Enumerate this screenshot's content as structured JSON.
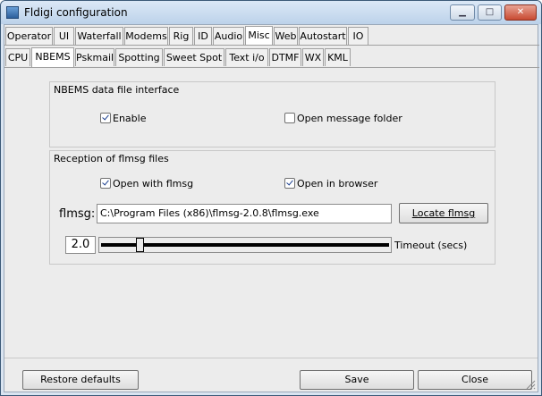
{
  "window": {
    "title": "Fldigi configuration"
  },
  "tabs_top": [
    "Operator",
    "UI",
    "Waterfall",
    "Modems",
    "Rig",
    "ID",
    "Audio",
    "Misc",
    "Web",
    "Autostart",
    "IO"
  ],
  "tabs_top_active": "Misc",
  "tabs_sub": [
    "CPU",
    "NBEMS",
    "Pskmail",
    "Spotting",
    "Sweet Spot",
    "Text i/o",
    "DTMF",
    "WX",
    "KML"
  ],
  "tabs_sub_active": "NBEMS",
  "nbems_interface": {
    "title": "NBEMS data file interface",
    "enable_label": "Enable",
    "enable_checked": true,
    "open_folder_label": "Open message folder",
    "open_folder_checked": false
  },
  "flmsg_reception": {
    "title": "Reception of flmsg files",
    "open_with_label": "Open with flmsg",
    "open_with_checked": true,
    "open_browser_label": "Open in browser",
    "open_browser_checked": true,
    "path_label": "flmsg:",
    "path_value": "C:\\Program Files (x86)\\flmsg-2.0.8\\flmsg.exe",
    "locate_label": "Locate flmsg",
    "timeout_value": "2.0",
    "timeout_label": "Timeout (secs)",
    "timeout_fraction": 0.13
  },
  "footer": {
    "restore_label": "Restore defaults",
    "save_label": "Save",
    "close_label": "Close"
  }
}
